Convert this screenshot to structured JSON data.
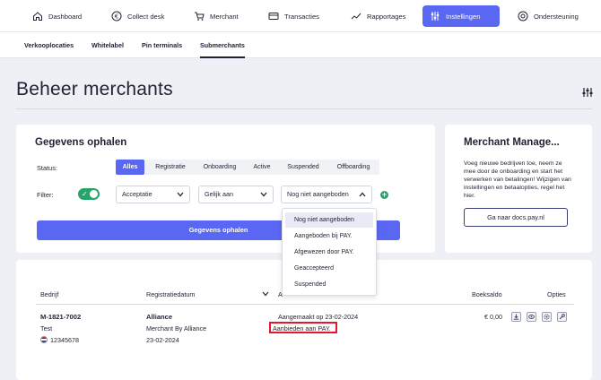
{
  "nav": {
    "items": [
      {
        "label": "Dashboard",
        "icon": "home-icon"
      },
      {
        "label": "Collect desk",
        "icon": "euro-icon"
      },
      {
        "label": "Merchant",
        "icon": "cart-icon"
      },
      {
        "label": "Transacties",
        "icon": "card-icon"
      },
      {
        "label": "Rapportages",
        "icon": "chart-icon"
      },
      {
        "label": "Instellingen",
        "icon": "sliders-icon",
        "active": true
      },
      {
        "label": "Ondersteuning",
        "icon": "support-icon"
      }
    ]
  },
  "subnav": {
    "items": [
      {
        "label": "Verkooplocaties"
      },
      {
        "label": "Whitelabel"
      },
      {
        "label": "Pin terminals"
      },
      {
        "label": "Submerchants",
        "active": true
      }
    ]
  },
  "page": {
    "title": "Beheer merchants"
  },
  "fetch": {
    "title": "Gegevens ophalen",
    "status_label": "Status:",
    "filter_label": "Filter:",
    "status_tabs": [
      "Alles",
      "Registratie",
      "Onboarding",
      "Active",
      "Suspended",
      "Offboarding"
    ],
    "active_status": "Alles",
    "filter_field": "Acceptatie",
    "filter_operator": "Gelijk aan",
    "filter_value": "Nog niet aangeboden",
    "submit_label": "Gegevens ophalen",
    "dropdown_options": [
      "Nog niet aangeboden",
      "Aangeboden bij PAY.",
      "Afgewezen door PAY.",
      "Geaccepteerd",
      "Suspended"
    ]
  },
  "side": {
    "title": "Merchant Manage...",
    "text": "Voeg nieuwe bedrijven toe, neem ze mee door de onboarding en start het verwerken van betalingen! Wijzigen van instellingen en betaalopties, regel het hier.",
    "button_label": "Ga naar docs.pay.nl"
  },
  "table": {
    "headers": {
      "company": "Bedrijf",
      "date": "Registratiedatum",
      "status": "A",
      "balance": "Boeksaldo",
      "options": "Opties"
    },
    "rows": [
      {
        "id": "M-1821-7002",
        "name": "Test",
        "phone": "12345678",
        "company": "Alliance",
        "subtitle": "Merchant By Alliance",
        "date": "23-02-2024",
        "status_line1": "Aangemaakt op 23-02-2024",
        "status_line2": "Aanbieden aan PAY.",
        "balance": "€ 0,00"
      }
    ]
  },
  "colors": {
    "accent": "#5a67f2",
    "success": "#26a46b",
    "highlight": "#e0192e"
  }
}
